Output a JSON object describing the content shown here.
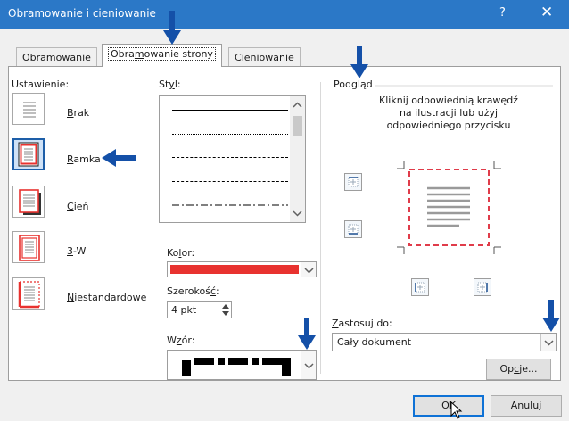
{
  "window": {
    "title": "Obramowanie i cieniowanie",
    "help": "?",
    "close": "✕"
  },
  "tabs": [
    {
      "pre": "",
      "u": "O",
      "post": "bramowanie"
    },
    {
      "pre": "Obra",
      "u": "m",
      "post": "owanie strony"
    },
    {
      "pre": "C",
      "u": "i",
      "post": "eniowanie"
    }
  ],
  "settings": {
    "label": "Ustawienie:",
    "items": [
      {
        "u": "B",
        "post": "rak"
      },
      {
        "u": "R",
        "post": "amka"
      },
      {
        "u": "C",
        "post": "ień"
      },
      {
        "u": "3",
        "post": "-W"
      },
      {
        "u": "N",
        "post": "iestandardowe"
      }
    ]
  },
  "style": {
    "pre": "St",
    "u": "y",
    "post": "l:"
  },
  "color": {
    "pre": "Ko",
    "u": "l",
    "post": "or:",
    "value": "#e8322f"
  },
  "width": {
    "pre": "Szerokoś",
    "u": "ć",
    "post": ":",
    "value": "4 pkt"
  },
  "art": {
    "pre": "W",
    "u": "z",
    "post": "ór:"
  },
  "preview": {
    "label": "Podgląd",
    "instruction": [
      "Kliknij odpowiednią krawędź",
      "na ilustracji lub użyj",
      "odpowiedniego przycisku"
    ],
    "frame_color": "#e03c4a"
  },
  "apply": {
    "u": "Z",
    "post": "astosuj do:",
    "value": "Cały dokument"
  },
  "buttons": {
    "options": {
      "pre": "Op",
      "u": "c",
      "post": "je..."
    },
    "ok": "OK",
    "cancel": "Anuluj"
  },
  "colors": {
    "title_bar": "#2b78c7",
    "annotation_arrow": "#1450a8",
    "selected_setting": "#1d5ea8"
  }
}
